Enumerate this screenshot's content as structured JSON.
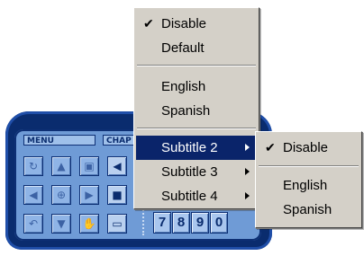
{
  "remote": {
    "menu_label": "MENU",
    "chapter_label": "CHAP",
    "number_keys": [
      "7",
      "8",
      "9",
      "0"
    ]
  },
  "main_menu": {
    "items": [
      {
        "label": "Disable",
        "checked": true
      },
      {
        "label": "Default",
        "checked": false
      },
      {
        "label": "English",
        "checked": false
      },
      {
        "label": "Spanish",
        "checked": false
      },
      {
        "label": "Subtitle 2",
        "has_submenu": true,
        "selected": true
      },
      {
        "label": "Subtitle 3",
        "has_submenu": true
      },
      {
        "label": "Subtitle 4",
        "has_submenu": true
      }
    ]
  },
  "submenu": {
    "items": [
      {
        "label": "Disable",
        "checked": true
      },
      {
        "label": "English",
        "checked": false
      },
      {
        "label": "Spanish",
        "checked": false
      }
    ]
  },
  "icons": {
    "check": "checkmark-icon",
    "submenu_arrow": "chevron-right-icon"
  },
  "colors": {
    "menu_bg": "#d4d0c8",
    "highlight": "#0a246a",
    "remote_body": "#0a2c6e",
    "remote_panel": "#6f9bd6"
  }
}
